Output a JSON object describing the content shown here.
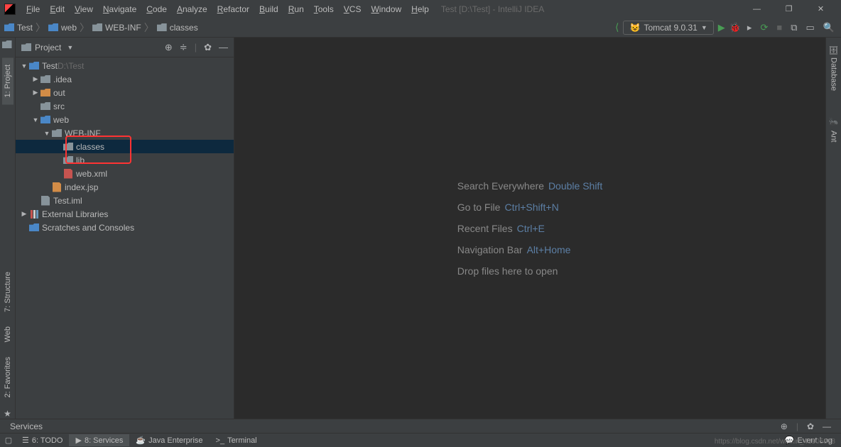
{
  "window": {
    "title": "Test [D:\\Test] - IntelliJ IDEA",
    "minimize": "—",
    "maximize": "❐",
    "close": "✕"
  },
  "menu": [
    "File",
    "Edit",
    "View",
    "Navigate",
    "Code",
    "Analyze",
    "Refactor",
    "Build",
    "Run",
    "Tools",
    "VCS",
    "Window",
    "Help"
  ],
  "breadcrumb": [
    {
      "icon": "folder-blue",
      "label": "Test"
    },
    {
      "icon": "folder-blue",
      "label": "web"
    },
    {
      "icon": "folder",
      "label": "WEB-INF"
    },
    {
      "icon": "folder",
      "label": "classes"
    }
  ],
  "run_config": {
    "label": "Tomcat 9.0.31"
  },
  "project_panel": {
    "title": "Project"
  },
  "tree": [
    {
      "indent": 0,
      "expand": "▼",
      "icon": "folder-blue",
      "label": "Test",
      "suffix": "D:\\Test"
    },
    {
      "indent": 1,
      "expand": "▶",
      "icon": "folder",
      "label": ".idea"
    },
    {
      "indent": 1,
      "expand": "▶",
      "icon": "folder-orange",
      "label": "out"
    },
    {
      "indent": 1,
      "expand": "",
      "icon": "folder",
      "label": "src"
    },
    {
      "indent": 1,
      "expand": "▼",
      "icon": "folder-blue",
      "label": "web"
    },
    {
      "indent": 2,
      "expand": "▼",
      "icon": "folder",
      "label": "WEB-INF"
    },
    {
      "indent": 3,
      "expand": "",
      "icon": "folder",
      "label": "classes",
      "selected": true
    },
    {
      "indent": 3,
      "expand": "",
      "icon": "folder",
      "label": "lib"
    },
    {
      "indent": 3,
      "expand": "",
      "icon": "xml",
      "label": "web.xml"
    },
    {
      "indent": 2,
      "expand": "",
      "icon": "jsp",
      "label": "index.jsp"
    },
    {
      "indent": 1,
      "expand": "",
      "icon": "file",
      "label": "Test.iml"
    },
    {
      "indent": 0,
      "expand": "▶",
      "icon": "lib",
      "label": "External Libraries"
    },
    {
      "indent": 0,
      "expand": "",
      "icon": "scratch",
      "label": "Scratches and Consoles"
    }
  ],
  "hints": [
    {
      "text": "Search Everywhere",
      "shortcut": "Double Shift"
    },
    {
      "text": "Go to File",
      "shortcut": "Ctrl+Shift+N"
    },
    {
      "text": "Recent Files",
      "shortcut": "Ctrl+E"
    },
    {
      "text": "Navigation Bar",
      "shortcut": "Alt+Home"
    },
    {
      "text": "Drop files here to open",
      "shortcut": ""
    }
  ],
  "left_tabs": [
    {
      "label": "1: Project",
      "active": true
    },
    {
      "label": "7: Structure",
      "active": false
    },
    {
      "label": "Web",
      "active": false
    },
    {
      "label": "2: Favorites",
      "active": false
    }
  ],
  "right_tabs": [
    {
      "label": "Database"
    },
    {
      "label": "Ant"
    }
  ],
  "services_label": "Services",
  "bottom_tabs": [
    {
      "icon": "☰",
      "label": "6: TODO"
    },
    {
      "icon": "▶",
      "label": "8: Services",
      "active": true
    },
    {
      "icon": "☕",
      "label": "Java Enterprise"
    },
    {
      "icon": ">_",
      "label": "Terminal"
    }
  ],
  "event_log": "Event Log",
  "watermark": "https://blog.csdn.net/weixin_43905908"
}
